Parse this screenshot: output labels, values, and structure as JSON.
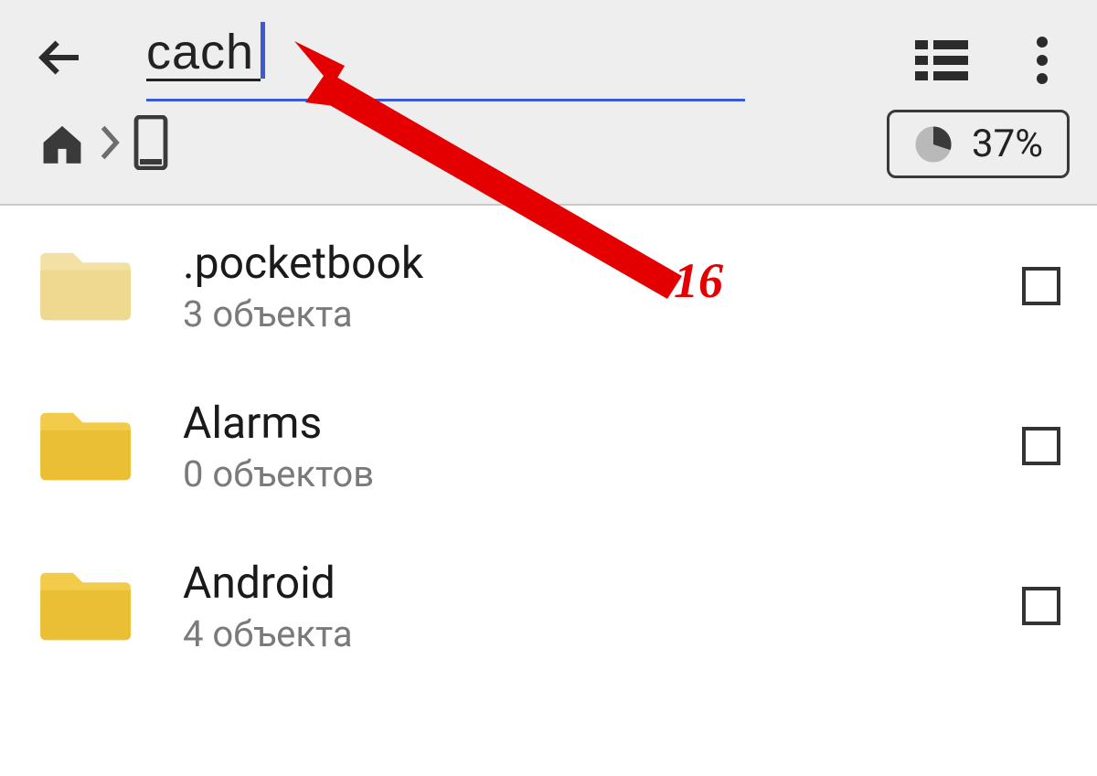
{
  "search": {
    "value": "cach",
    "placeholder": ""
  },
  "storage": {
    "percent": "37%"
  },
  "files": [
    {
      "name": ".pocketbook",
      "sub": "3 объекта",
      "tint": "light"
    },
    {
      "name": "Alarms",
      "sub": "0 объектов",
      "tint": "normal"
    },
    {
      "name": "Android",
      "sub": "4 объекта",
      "tint": "normal"
    }
  ],
  "annotation": {
    "label": "16"
  },
  "icons": {
    "back": "back-icon",
    "view": "list-view-icon",
    "more": "more-vert-icon",
    "home": "home-icon",
    "chevron": "chevron-right-icon",
    "device": "device-icon",
    "pie": "pie-icon"
  }
}
